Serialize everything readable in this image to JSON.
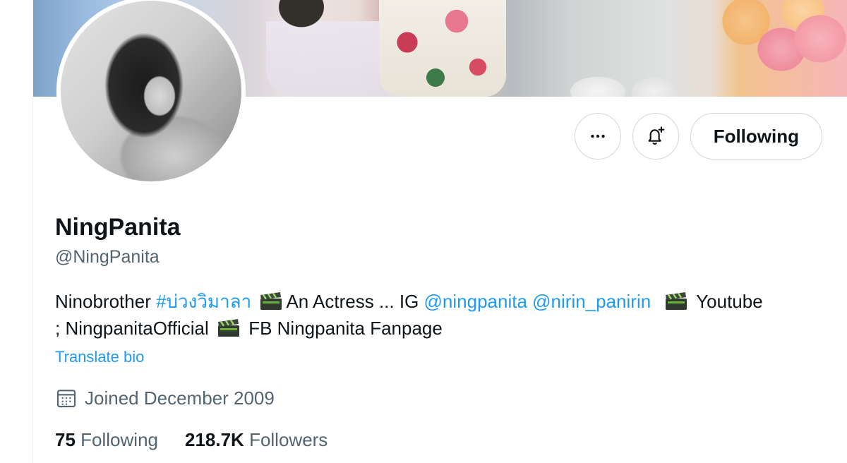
{
  "profile": {
    "display_name": "NingPanita",
    "handle": "@NingPanita"
  },
  "actions": {
    "more_icon": "more-horizontal-icon",
    "notify_icon": "bell-plus-icon",
    "follow_label": "Following"
  },
  "bio": {
    "text_1": "Ninobrother ",
    "hashtag": "#บ่วงวิมาลา",
    "text_2": "An Actress ... IG ",
    "mention_1": "@ningpanita",
    "mention_2": "@nirin_panirin",
    "text_3": " Youtube",
    "text_4": "; NingpanitaOfficial ",
    "text_5": " FB Ningpanita Fanpage",
    "emoji_icon": "clapper-board-icon",
    "translate_label": "Translate bio"
  },
  "joined": {
    "icon": "calendar-icon",
    "text": "Joined December 2009"
  },
  "stats": {
    "following_count": "75",
    "following_label": "Following",
    "followers_count": "218.7K",
    "followers_label": "Followers"
  },
  "colors": {
    "link": "#1d9bf0",
    "secondary_text": "#536471",
    "primary_text": "#0f1419",
    "border": "#cfd9de"
  }
}
